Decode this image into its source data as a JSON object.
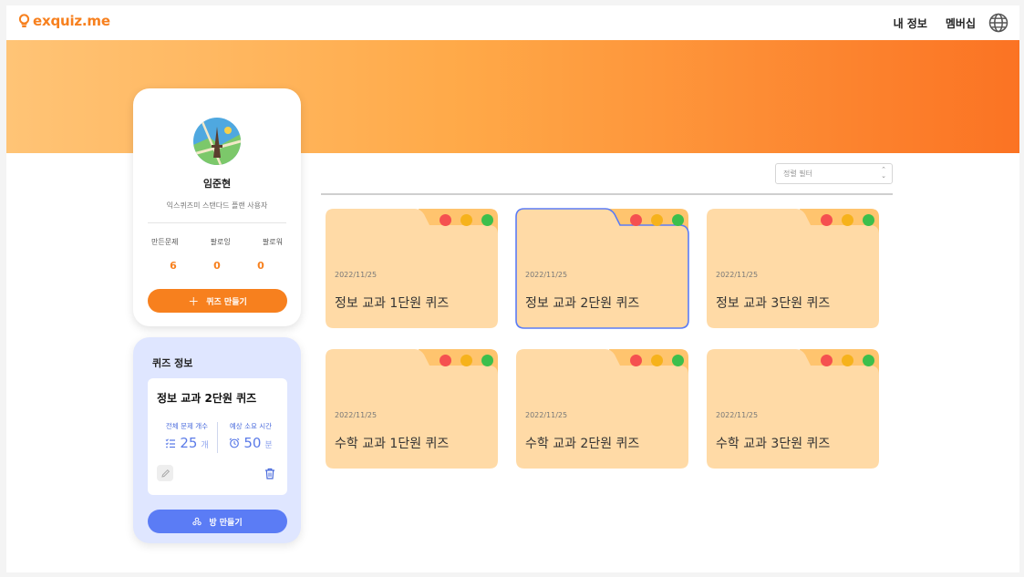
{
  "header": {
    "logo_text": "exquiz.me",
    "nav": {
      "my_info": "내 정보",
      "membership": "멤버십"
    }
  },
  "profile": {
    "name": "임준현",
    "plan": "익스퀴즈미 스탠다드 플랜 사용자",
    "stats": [
      {
        "label": "만든문제",
        "value": "6"
      },
      {
        "label": "팔로잉",
        "value": "0"
      },
      {
        "label": "팔로워",
        "value": "0"
      }
    ],
    "create_quiz_button": "퀴즈 만들기"
  },
  "quiz_info": {
    "title": "퀴즈 정보",
    "selected_name": "정보 교과 2단원 퀴즈",
    "total_questions_label": "전체 문제 개수",
    "total_questions_value": "25",
    "total_questions_unit": "개",
    "expected_time_label": "예상 소요 시간",
    "expected_time_value": "50",
    "expected_time_unit": "분",
    "make_room_button": "방 만들기"
  },
  "sort": {
    "placeholder": "정렬 필터"
  },
  "quizzes": [
    {
      "date": "2022/11/25",
      "title": "정보 교과 1단원 퀴즈"
    },
    {
      "date": "2022/11/25",
      "title": "정보 교과 2단원 퀴즈"
    },
    {
      "date": "2022/11/25",
      "title": "정보 교과 3단원 퀴즈"
    },
    {
      "date": "2022/11/25",
      "title": "수학 교과 1단원 퀴즈"
    },
    {
      "date": "2022/11/25",
      "title": "수학 교과 2단원 퀴즈"
    },
    {
      "date": "2022/11/25",
      "title": "수학 교과 3단원 퀴즈"
    }
  ],
  "selected_quiz_index": 1,
  "colors": {
    "brand_orange": "#f7801e",
    "accent_blue": "#5b7cf5",
    "folder_fill": "#ffdaa6",
    "folder_tab": "#ffc46e"
  }
}
